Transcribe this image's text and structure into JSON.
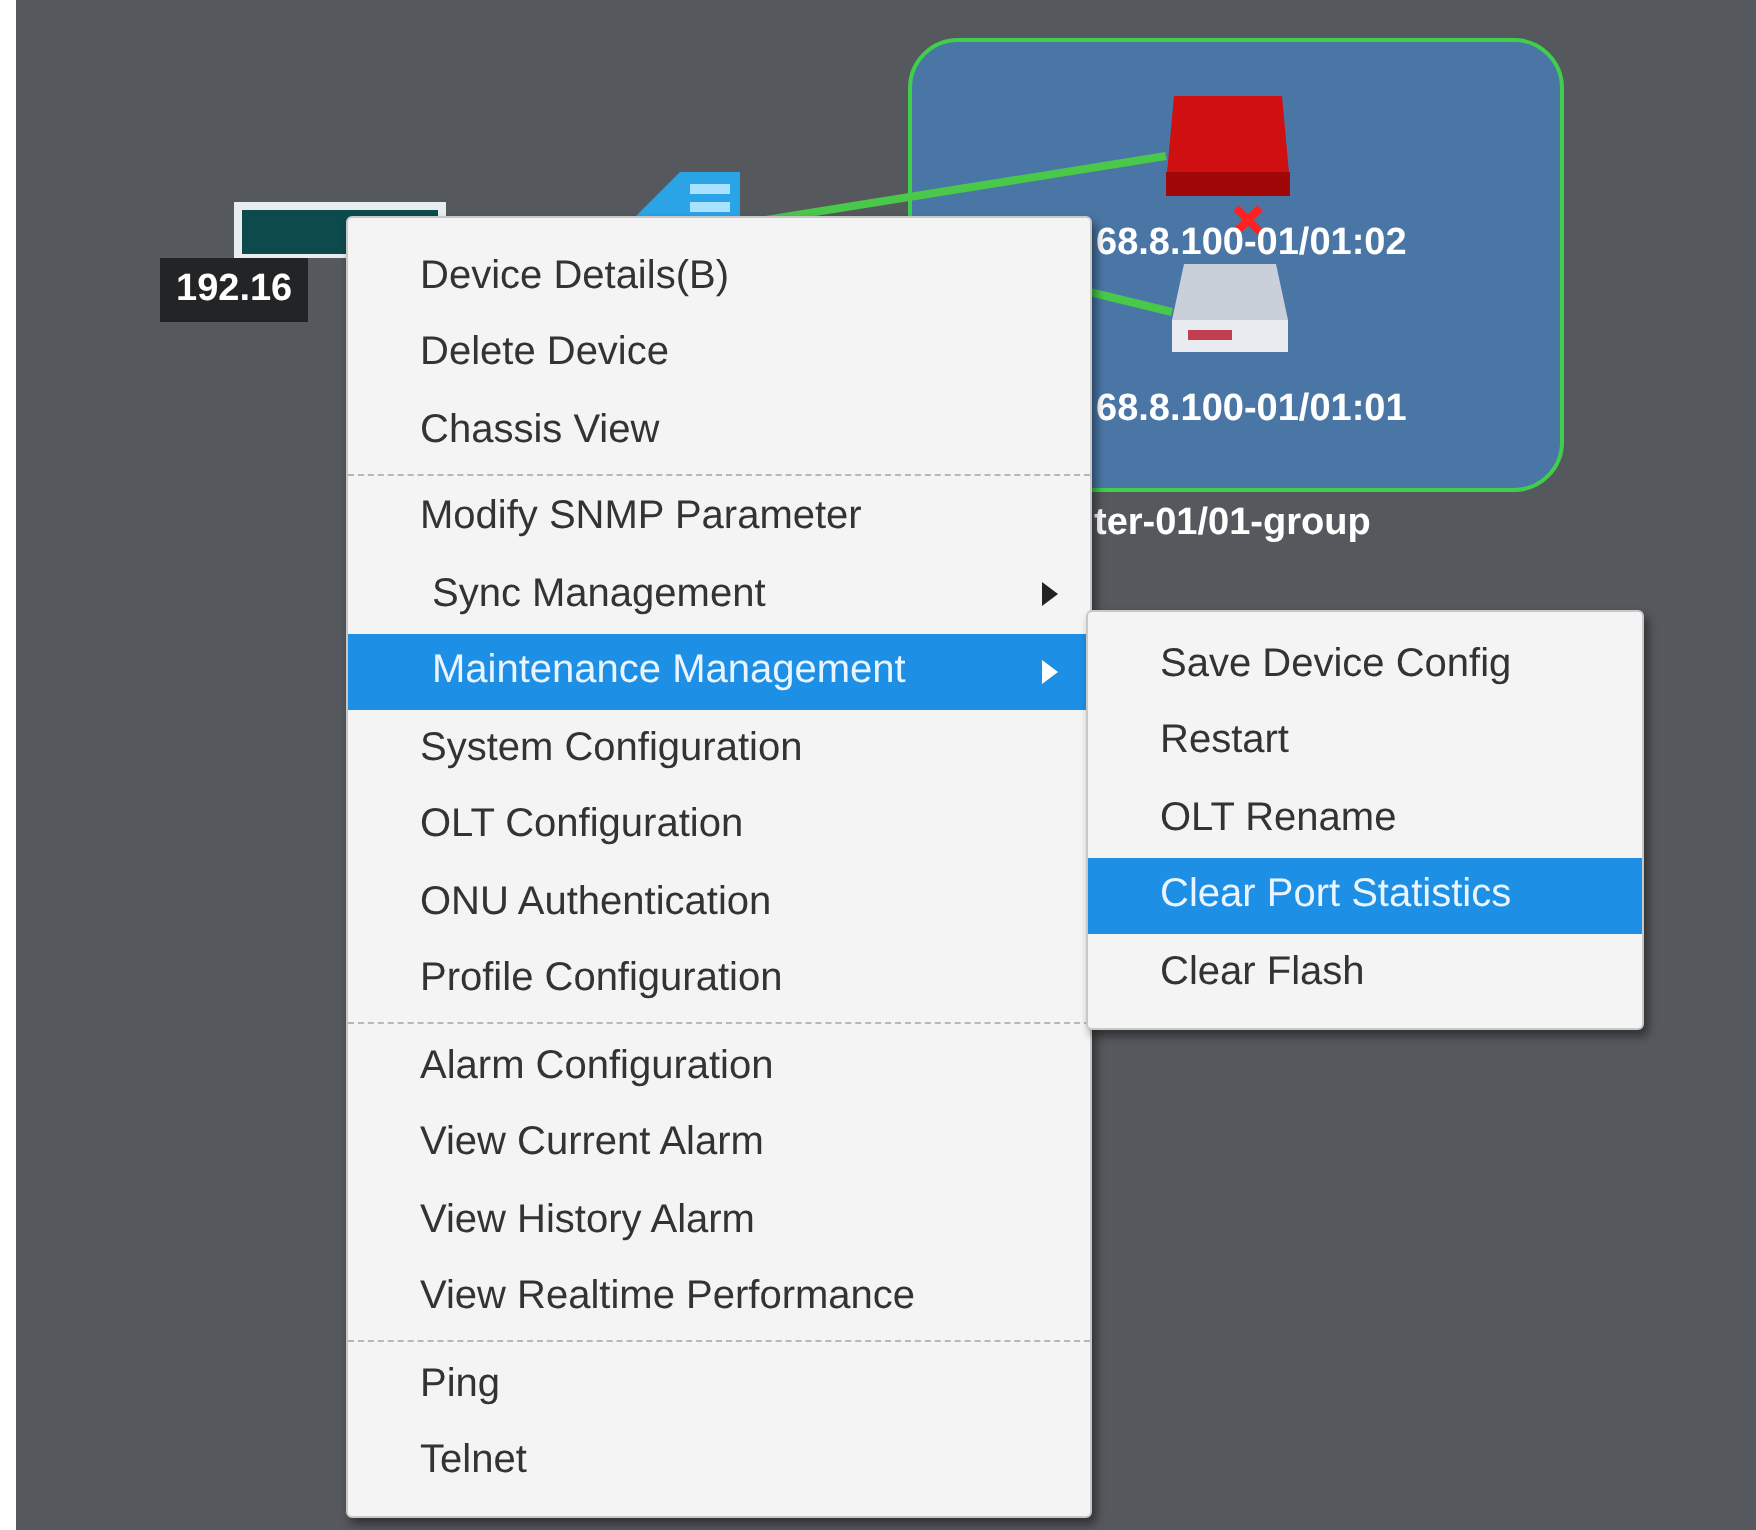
{
  "topology": {
    "device_label": "192.16",
    "group_title": "ter-01/01-group",
    "group_members": [
      {
        "label": "68.8.100-01/01:02",
        "kind": "alarm"
      },
      {
        "label": "68.8.100-01/01:01",
        "kind": "normal"
      }
    ]
  },
  "context_menu": {
    "groups": [
      [
        {
          "label": "Device Details(B)",
          "kind": "action",
          "selected": false
        },
        {
          "label": "Delete Device",
          "kind": "action",
          "selected": false
        },
        {
          "label": "Chassis View",
          "kind": "action",
          "selected": false
        }
      ],
      [
        {
          "label": "Modify SNMP Parameter",
          "kind": "action",
          "selected": false
        },
        {
          "label": "Sync Management",
          "kind": "submenu",
          "selected": false
        },
        {
          "label": "Maintenance Management",
          "kind": "submenu",
          "selected": true
        },
        {
          "label": "System Configuration",
          "kind": "action",
          "selected": false
        },
        {
          "label": "OLT Configuration",
          "kind": "action",
          "selected": false
        },
        {
          "label": "ONU Authentication",
          "kind": "action",
          "selected": false
        },
        {
          "label": "Profile Configuration",
          "kind": "action",
          "selected": false
        }
      ],
      [
        {
          "label": "Alarm Configuration",
          "kind": "action",
          "selected": false
        },
        {
          "label": "View Current Alarm",
          "kind": "action",
          "selected": false
        },
        {
          "label": "View History Alarm",
          "kind": "action",
          "selected": false
        },
        {
          "label": "View Realtime Performance",
          "kind": "action",
          "selected": false
        }
      ],
      [
        {
          "label": "Ping",
          "kind": "action",
          "selected": false
        },
        {
          "label": "Telnet",
          "kind": "action",
          "selected": false
        }
      ]
    ]
  },
  "submenu": {
    "items": [
      {
        "label": "Save Device Config",
        "selected": false
      },
      {
        "label": "Restart",
        "selected": false
      },
      {
        "label": "OLT Rename",
        "selected": false
      },
      {
        "label": "Clear Port Statistics",
        "selected": true
      },
      {
        "label": "Clear Flash",
        "selected": false
      }
    ]
  }
}
